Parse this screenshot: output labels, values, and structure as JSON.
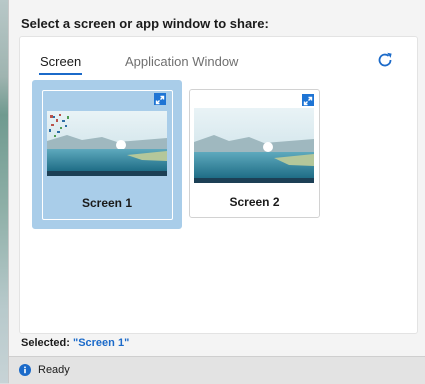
{
  "dialog": {
    "prompt": "Select a screen or app window to share:",
    "tabs": [
      {
        "label": "Screen",
        "active": true
      },
      {
        "label": "Application Window",
        "active": false
      }
    ],
    "refresh_icon": "refresh-icon",
    "sources": [
      {
        "label": "Screen 1",
        "selected": true,
        "expand_icon": "expand-icon"
      },
      {
        "label": "Screen 2",
        "selected": false,
        "expand_icon": "expand-icon"
      }
    ],
    "selected_prefix": "Selected:",
    "selected_value": "\"Screen 1\""
  },
  "status": {
    "icon": "info-icon",
    "text": "Ready"
  },
  "colors": {
    "accent": "#1b6ac9",
    "selected_tile": "#a9cde9",
    "expand_badge": "#1e74d4"
  }
}
